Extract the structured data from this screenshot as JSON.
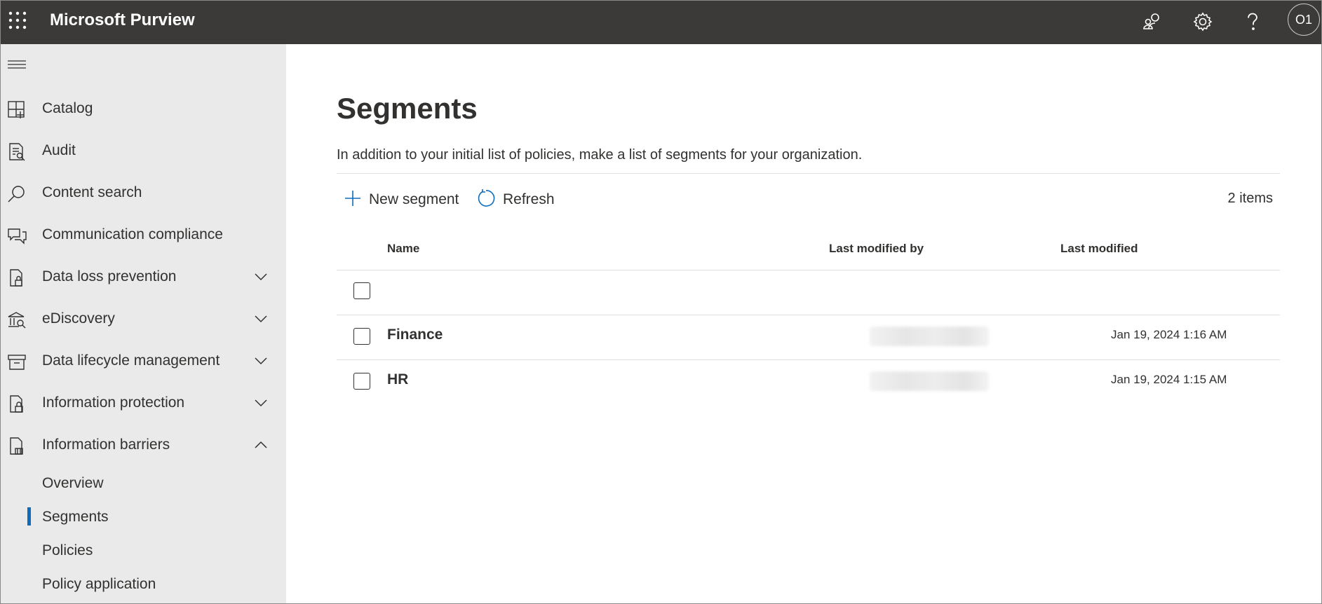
{
  "topbar": {
    "app_title": "Microsoft Purview",
    "waffle_icon": "app-launcher-icon",
    "icons": [
      "community-icon",
      "gear-icon",
      "help-icon"
    ],
    "avatar_initials": "O1",
    "background": "#3b3a39"
  },
  "sidebar": {
    "menu_icon": "hamburger-icon",
    "items": [
      {
        "label": "Catalog",
        "icon": "catalog-icon",
        "expandable": false
      },
      {
        "label": "Audit",
        "icon": "audit-icon",
        "expandable": false
      },
      {
        "label": "Content search",
        "icon": "search-icon",
        "expandable": false
      },
      {
        "label": "Communication compliance",
        "icon": "chat-icon",
        "expandable": false
      },
      {
        "label": "Data loss prevention",
        "icon": "dlp-icon",
        "expandable": true,
        "expanded": false
      },
      {
        "label": "eDiscovery",
        "icon": "ediscovery-icon",
        "expandable": true,
        "expanded": false
      },
      {
        "label": "Data lifecycle management",
        "icon": "archive-icon",
        "expandable": true,
        "expanded": false
      },
      {
        "label": "Information protection",
        "icon": "info-protection-icon",
        "expandable": true,
        "expanded": false
      },
      {
        "label": "Information barriers",
        "icon": "info-barriers-icon",
        "expandable": true,
        "expanded": true
      }
    ],
    "sub_items": [
      {
        "label": "Overview",
        "selected": false
      },
      {
        "label": "Segments",
        "selected": true
      },
      {
        "label": "Policies",
        "selected": false
      },
      {
        "label": "Policy application",
        "selected": false
      }
    ],
    "background": "#eaeaea",
    "accent": "#0f6cbd"
  },
  "main": {
    "title": "Segments",
    "description": "In addition to your initial list of policies, make a list of segments for your organization.",
    "commands": {
      "new_label": "New segment",
      "refresh_label": "Refresh"
    },
    "item_count": "2 items",
    "table": {
      "columns": [
        "Name",
        "Last modified by",
        "Last modified"
      ],
      "rows": [
        {
          "name": "Finance",
          "modified_by": "",
          "modified": "Jan 19, 2024 1:16 AM"
        },
        {
          "name": "HR",
          "modified_by": "",
          "modified": "Jan 19, 2024 1:15 AM"
        }
      ]
    }
  }
}
